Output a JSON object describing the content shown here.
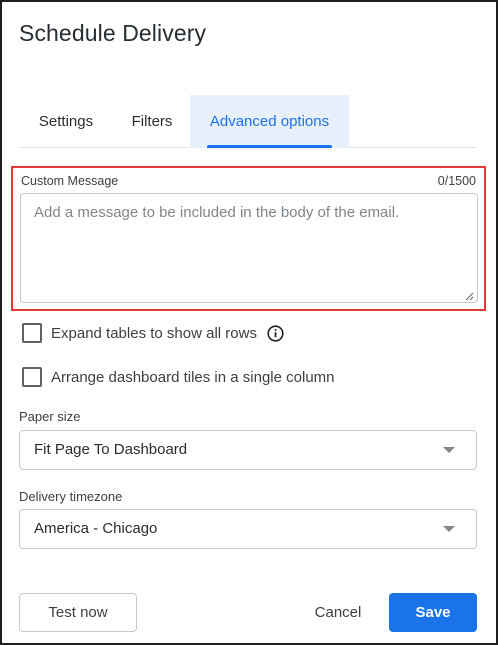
{
  "dialog": {
    "title": "Schedule Delivery"
  },
  "tabs": [
    {
      "label": "Settings",
      "active": false
    },
    {
      "label": "Filters",
      "active": false
    },
    {
      "label": "Advanced options",
      "active": true
    }
  ],
  "custom_message": {
    "label": "Custom Message",
    "counter": "0/1500",
    "value": "",
    "placeholder": "Add a message to be included in the body of the email."
  },
  "options": {
    "expand_tables": {
      "label": "Expand tables to show all rows",
      "checked": false,
      "icon": "info-icon"
    },
    "single_column": {
      "label": "Arrange dashboard tiles in a single column",
      "checked": false
    }
  },
  "paper_size": {
    "label": "Paper size",
    "value": "Fit Page To Dashboard"
  },
  "delivery_timezone": {
    "label": "Delivery timezone",
    "value": "America - Chicago"
  },
  "buttons": {
    "test_now": "Test now",
    "cancel": "Cancel",
    "save": "Save"
  },
  "colors": {
    "accent": "#1a73e8",
    "active_tab_bg": "#e8f0fb",
    "highlight_border": "#e53935",
    "dialog_border": "#1f1f1f"
  }
}
